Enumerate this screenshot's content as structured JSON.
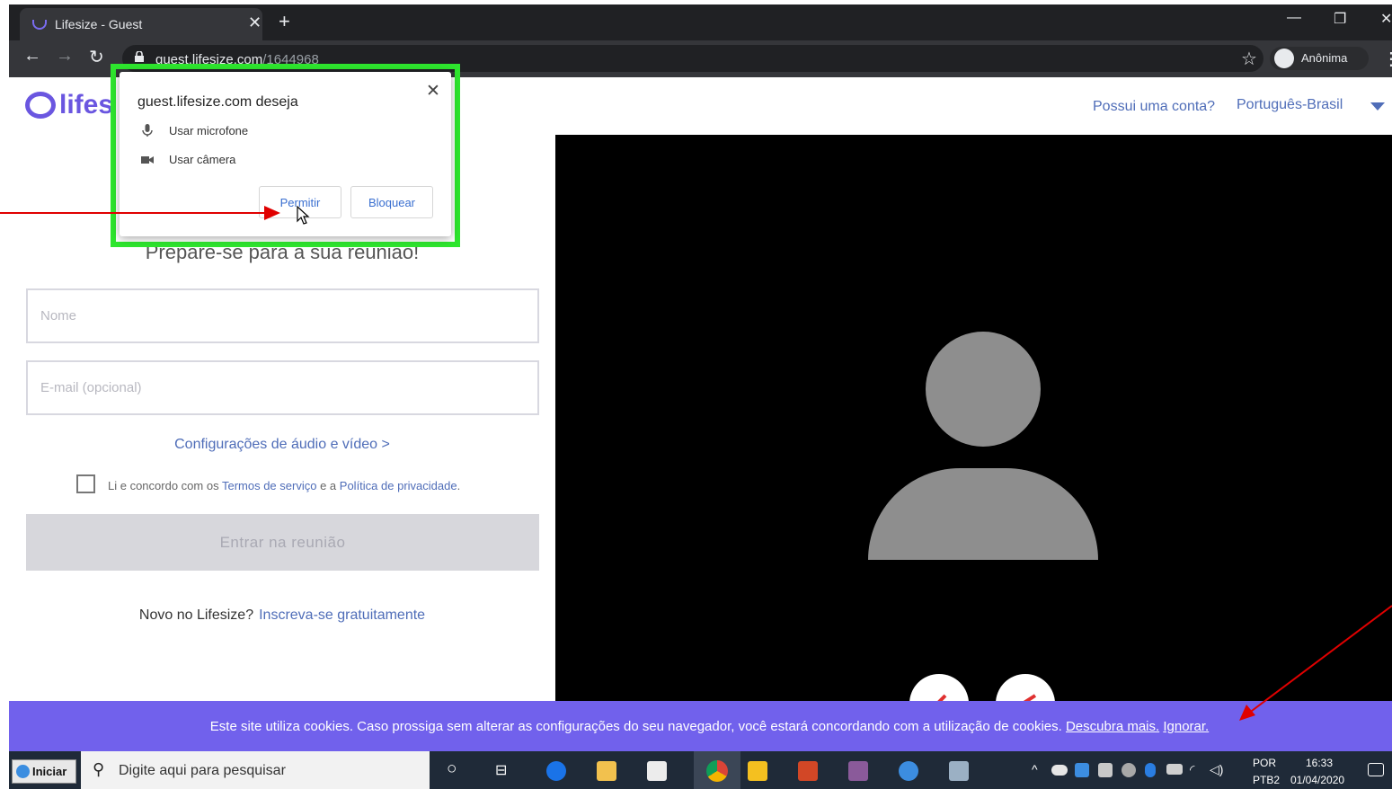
{
  "browser": {
    "tab_title": "Lifesize - Guest",
    "url_host": "guest.lifesize.com",
    "url_path": "/1644968",
    "incognito_label": "Anônima"
  },
  "header": {
    "logo_text": "lifes",
    "account_link": "Possui uma conta?",
    "language": "Português-Brasil"
  },
  "form": {
    "heading": "Prepare-se para a sua reunião!",
    "name_placeholder": "Nome",
    "email_placeholder": "E-mail (opcional)",
    "av_settings_link": "Configurações de áudio e vídeo >",
    "terms_prefix": "Li e concordo com os",
    "terms_link": "Termos de serviço",
    "terms_middle": "e a",
    "privacy_link": "Política de privacidade",
    "terms_suffix": ".",
    "enter_button": "Entrar na reunião",
    "new_user_text": "Novo no Lifesize?",
    "signup_link": "Inscreva-se gratuitamente"
  },
  "permission_popup": {
    "title": "guest.lifesize.com deseja",
    "microphone": "Usar microfone",
    "camera": "Usar câmera",
    "allow_button": "Permitir",
    "block_button": "Bloquear"
  },
  "cookie_bar": {
    "message": "Este site utiliza cookies. Caso prossiga sem alterar as configurações do seu navegador, você estará concordando com a utilização de cookies.",
    "learn_more": "Descubra mais.",
    "ignore": "Ignorar."
  },
  "taskbar": {
    "start_label": "Iniciar",
    "search_placeholder": "Digite aqui para pesquisar",
    "lang_top": "POR",
    "lang_bottom": "PTB2",
    "time": "16:33",
    "date": "01/04/2020"
  },
  "colors": {
    "accent": "#6a56e0",
    "link": "#4f6db8",
    "cookie_bg": "#7161ec",
    "highlight": "#2ee62e",
    "arrow": "#e00000"
  }
}
